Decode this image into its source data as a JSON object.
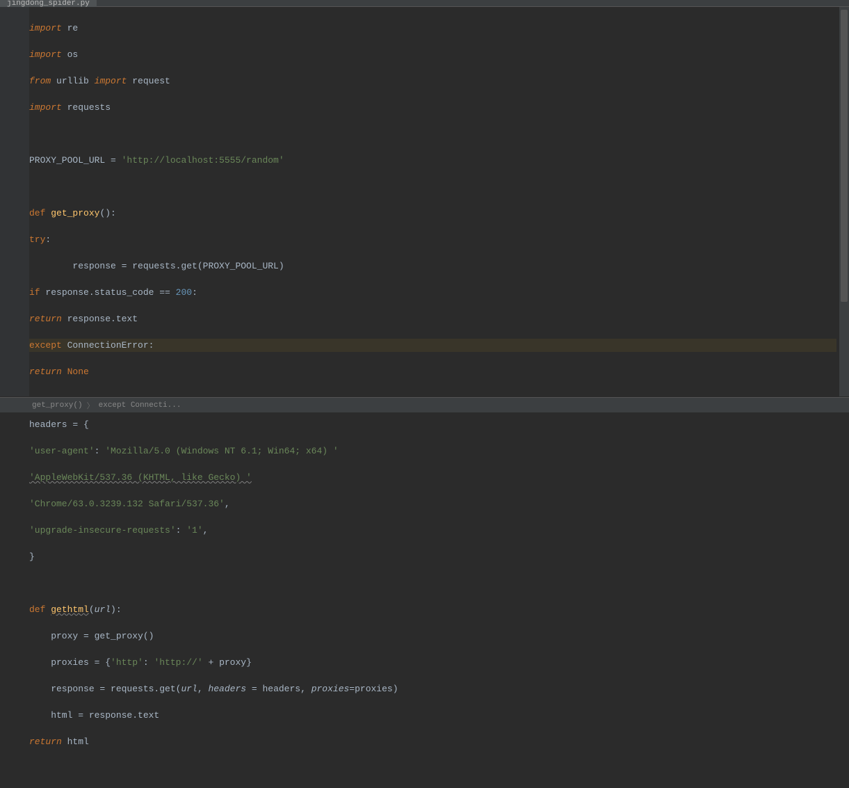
{
  "tab": {
    "filename": "jingdong_spider.py"
  },
  "breadcrumb": {
    "item1": "get_proxy()",
    "item2": "except Connecti..."
  },
  "code": {
    "l1_kw": "import",
    "l1_mod": " re",
    "l2_kw": "import",
    "l2_mod": " os",
    "l3_kw1": "from",
    "l3_mod1": " urllib ",
    "l3_kw2": "import",
    "l3_mod2": " request",
    "l4_kw": "import",
    "l4_mod": " requests",
    "l6_var": "PROXY_POOL_URL = ",
    "l6_str": "'http://localhost:5555/random'",
    "l8_kw": "def ",
    "l8_fn": "get_proxy",
    "l8_paren": "():",
    "l9_kw": "try",
    "l9_colon": ":",
    "l10_txt": "        response = requests.get(PROXY_POOL_URL)",
    "l11_kw": "if",
    "l11_txt1": " response.status_code == ",
    "l11_num": "200",
    "l11_colon": ":",
    "l12_kw": "return",
    "l12_txt": " response.text",
    "l13_kw": "except",
    "l13_txt": " ConnectionError",
    "l13_colon": ":",
    "l14_kw1": "return ",
    "l14_kw2": "None",
    "l16_txt": "headers = {",
    "l17_key": "'user-agent'",
    "l17_sep": ": ",
    "l17_val": "'Mozilla/5.0 (Windows NT 6.1; Win64; x64) '",
    "l18_val": "'AppleWebKit/537.36 (KHTML, like Gecko) '",
    "l19_val": "'Chrome/63.0.3239.132 Safari/537.36'",
    "l19_comma": ",",
    "l20_key": "'upgrade-insecure-requests'",
    "l20_sep": ": ",
    "l20_val": "'1'",
    "l20_comma": ",",
    "l21_txt": "}",
    "l23_kw": "def ",
    "l23_fn": "gethtml",
    "l23_p1": "(",
    "l23_param": "url",
    "l23_p2": "):",
    "l24_txt": "    proxy = get_proxy()",
    "l25_txt1": "    proxies = {",
    "l25_str1": "'http'",
    "l25_sep": ": ",
    "l25_str2": "'http://'",
    "l25_txt2": " + proxy}",
    "l26_txt1": "    response = requests.get(",
    "l26_p1": "url",
    "l26_txt2": ", ",
    "l26_p2": "headers",
    "l26_txt3": " = headers, ",
    "l26_p3": "proxies",
    "l26_txt4": "=proxies)",
    "l27_txt": "    html = response.text",
    "l28_kw": "return",
    "l28_txt": " html"
  }
}
